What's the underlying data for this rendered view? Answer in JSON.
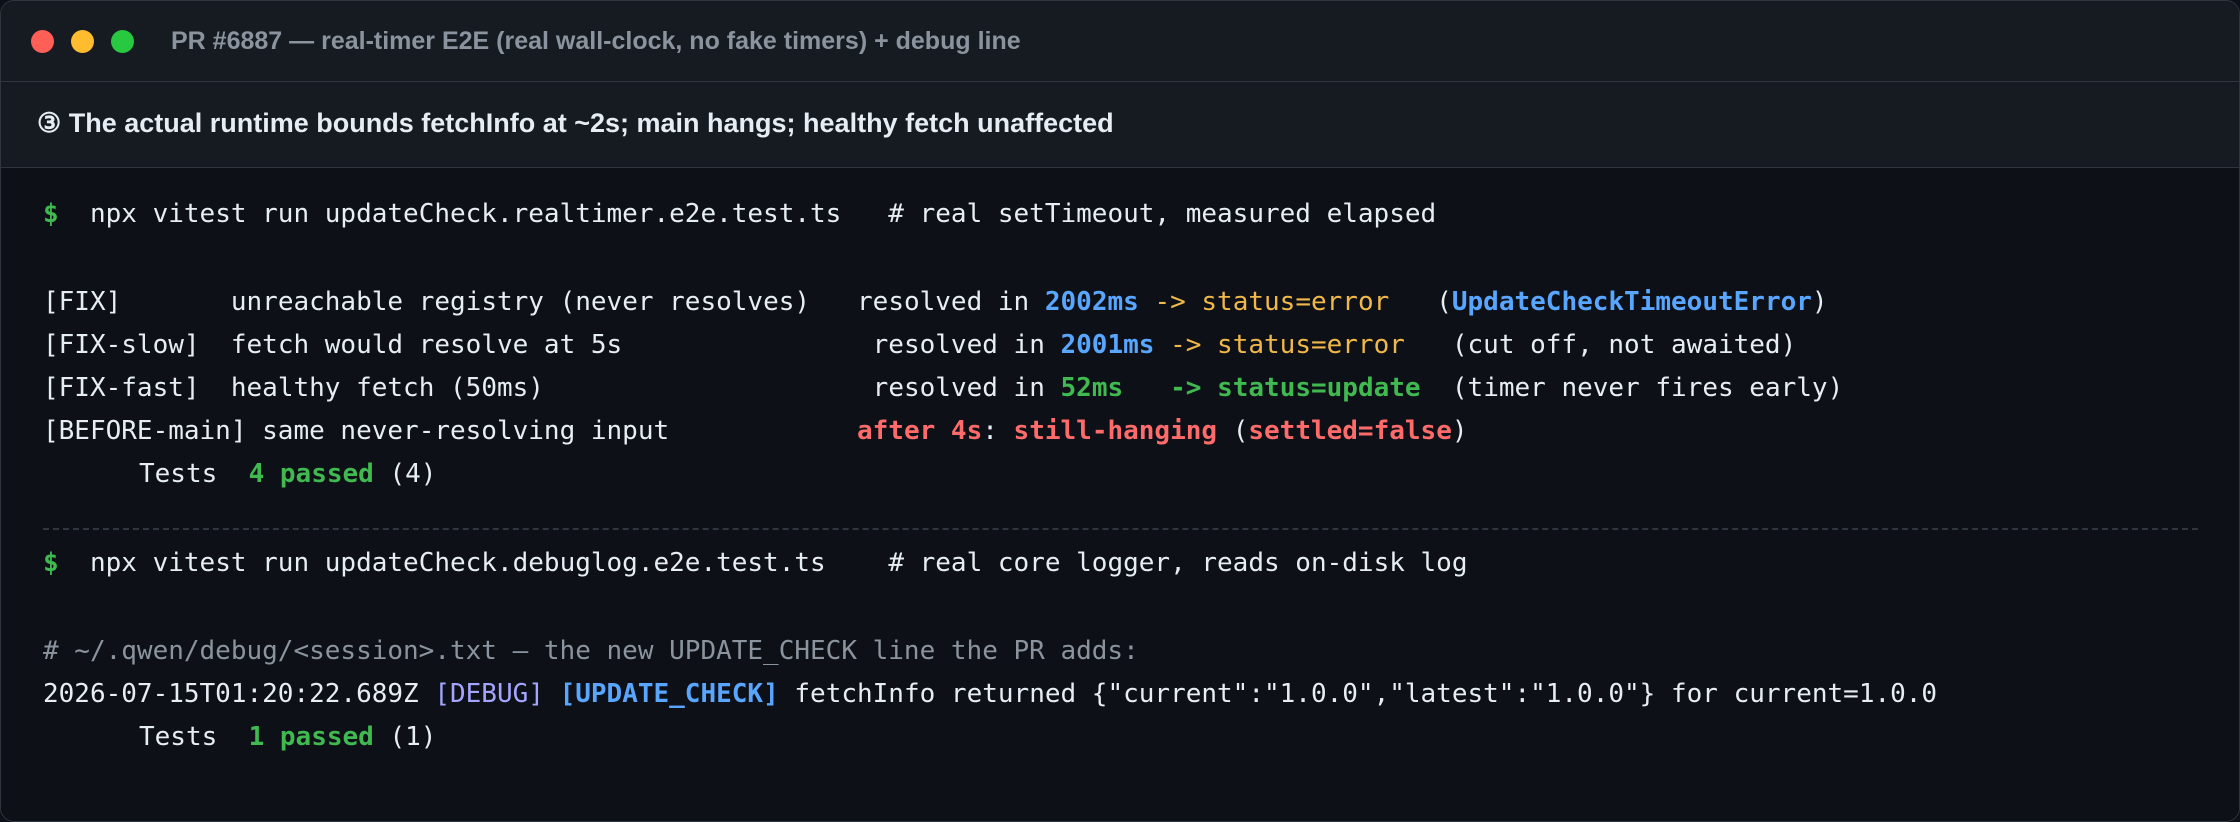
{
  "window": {
    "title": "PR #6887 — real-timer E2E (real wall-clock, no fake timers) + debug line"
  },
  "caption": "③ The actual runtime bounds fetchInfo at ~2s; main hangs; healthy fetch unaffected",
  "run1": {
    "prompt": "$",
    "command": "npx vitest run updateCheck.realtimer.e2e.test.ts",
    "comment": "# real setTimeout, measured elapsed",
    "rows": [
      {
        "tag": "[FIX]",
        "desc": "unreachable registry (never resolves)",
        "resolved_prefix": "resolved in",
        "ms": "2002ms",
        "arrow": "->",
        "status": "status=error",
        "note_open": "(",
        "note": "UpdateCheckTimeoutError",
        "note_close": ")"
      },
      {
        "tag": "[FIX-slow]",
        "desc": "fetch would resolve at 5s",
        "resolved_prefix": "resolved in",
        "ms": "2001ms",
        "arrow": "->",
        "status": "status=error",
        "note": "(cut off, not awaited)"
      },
      {
        "tag": "[FIX-fast]",
        "desc": "healthy fetch (50ms)",
        "resolved_prefix": "resolved in",
        "ms": "52ms",
        "arrow": "->",
        "status": "status=update",
        "note": "(timer never fires early)"
      },
      {
        "tag": "[BEFORE-main]",
        "desc": "same never-resolving input",
        "after": "after 4s",
        "colon": ":",
        "state": "still-hanging",
        "paren_open": "(",
        "settled": "settled=false",
        "paren_close": ")"
      }
    ],
    "tests_label": "Tests",
    "passed": "4 passed",
    "total": "(4)"
  },
  "run2": {
    "prompt": "$",
    "command": "npx vitest run updateCheck.debuglog.e2e.test.ts",
    "comment": "# real core logger, reads on-disk log",
    "log_comment": "# ~/.qwen/debug/<session>.txt — the new UPDATE_CHECK line the PR adds:",
    "log_timestamp": "2026-07-15T01:20:22.689Z",
    "log_level": "[DEBUG]",
    "log_tag": "[UPDATE_CHECK]",
    "log_message": "fetchInfo returned {\"current\":\"1.0.0\",\"latest\":\"1.0.0\"} for current=1.0.0",
    "tests_label": "Tests",
    "passed": "1 passed",
    "total": "(1)"
  },
  "colors": {
    "background": "#0d1117",
    "prompt": "#3fb950",
    "milliseconds": "#58a6ff",
    "status": "#f0b849",
    "error": "#ff6b6b",
    "debug": "#a5a5ff"
  }
}
